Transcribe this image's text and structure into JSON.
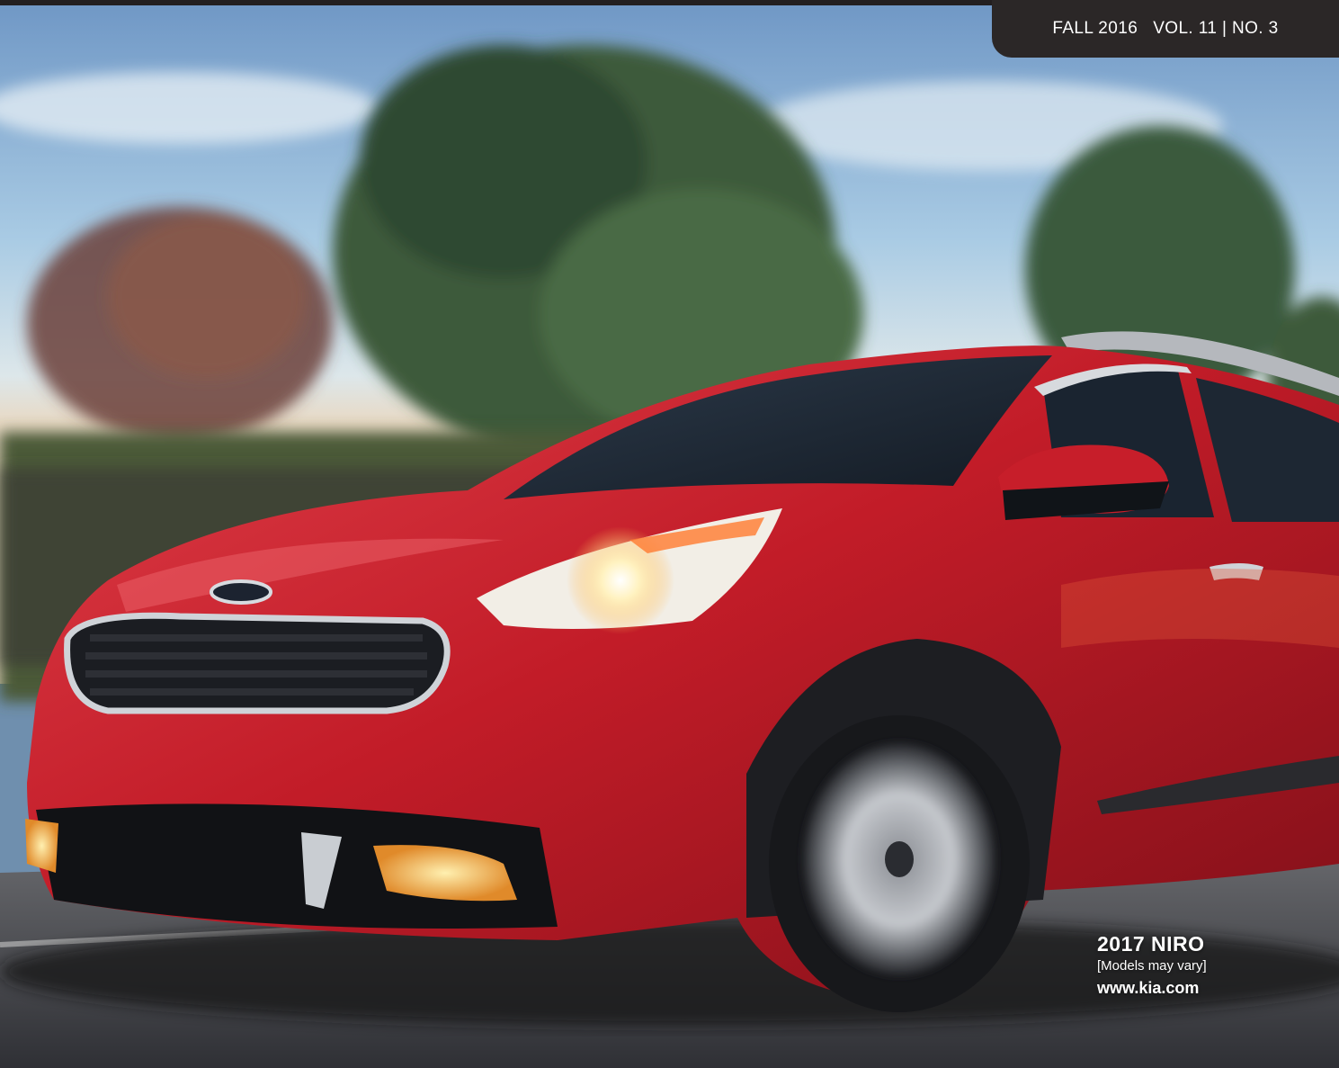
{
  "masthead": {
    "season": "FALL 2016",
    "volume": "VOL. 11 | NO. 3"
  },
  "caption": {
    "model": "2017 NIRO",
    "note": "[Models may vary]",
    "url": "www.kia.com"
  },
  "photo": {
    "subject": "car-photo",
    "colors": {
      "sky": "#9cc3e0",
      "car_body": "#c51f2b",
      "foliage": "#3f5a3c",
      "road": "#4d4f55"
    }
  }
}
